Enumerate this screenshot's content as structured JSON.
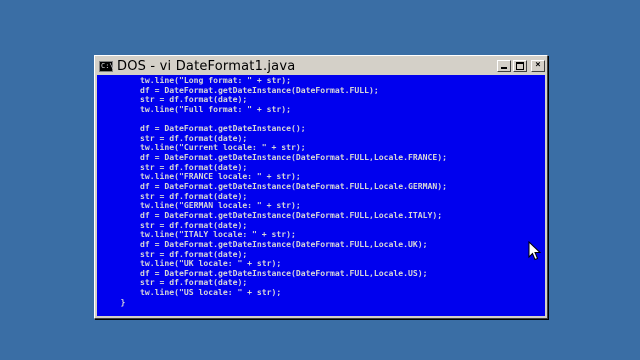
{
  "window": {
    "title": "DOS - vi DateFormat1.java",
    "icon": "console-icon",
    "icon_text": "C:\\",
    "buttons": {
      "minimize": "minimize-icon",
      "maximize": "maximize-icon",
      "close": "close-icon",
      "close_glyph": "×"
    }
  },
  "editor": {
    "lines": [
      "        tw.line(\"Long format: \" + str);",
      "        df = DateFormat.getDateInstance(DateFormat.FULL);",
      "        str = df.format(date);",
      "        tw.line(\"Full format: \" + str);",
      "",
      "        df = DateFormat.getDateInstance();",
      "        str = df.format(date);",
      "        tw.line(\"Current locale: \" + str);",
      "        df = DateFormat.getDateInstance(DateFormat.FULL,Locale.FRANCE);",
      "        str = df.format(date);",
      "        tw.line(\"FRANCE locale: \" + str);",
      "        df = DateFormat.getDateInstance(DateFormat.FULL,Locale.GERMAN);",
      "        str = df.format(date);",
      "        tw.line(\"GERMAN locale: \" + str);",
      "        df = DateFormat.getDateInstance(DateFormat.FULL,Locale.ITALY);",
      "        str = df.format(date);",
      "        tw.line(\"ITALY locale: \" + str);",
      "        df = DateFormat.getDateInstance(DateFormat.FULL,Locale.UK);",
      "        str = df.format(date);",
      "        tw.line(\"UK locale: \" + str);",
      "        df = DateFormat.getDateInstance(DateFormat.FULL,Locale.US);",
      "        str = df.format(date);",
      "        tw.line(\"US locale: \" + str);",
      "    }"
    ]
  },
  "colors": {
    "desktop": "#3a6ea5",
    "console_bg": "#0000ee",
    "console_fg": "#d8d8d8",
    "window_chrome": "#d4d0c8"
  },
  "cursor": "arrow-cursor-icon"
}
